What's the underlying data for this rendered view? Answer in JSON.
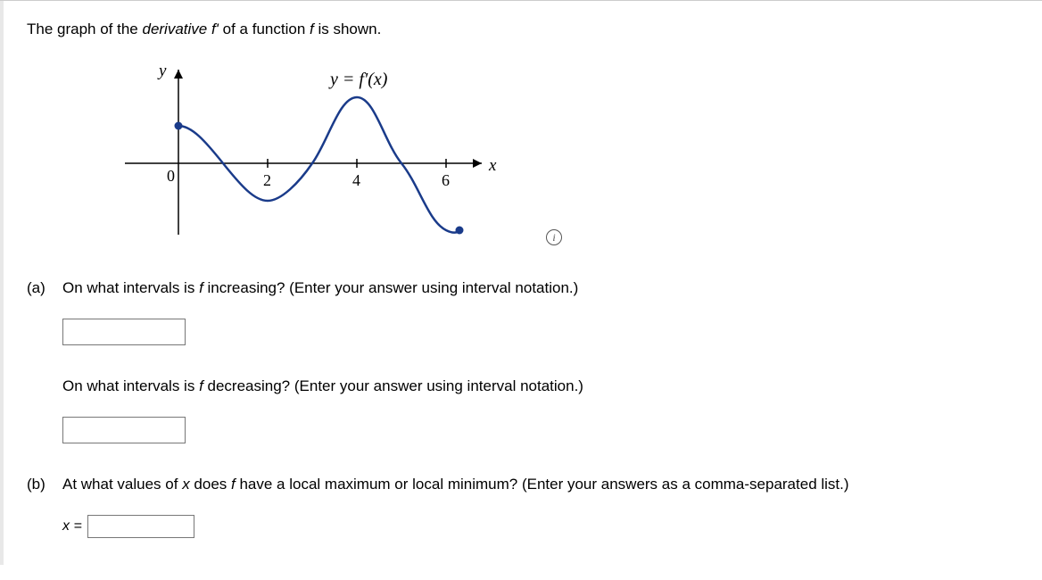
{
  "problem": {
    "prefix": "The graph of the ",
    "derivative_word": "derivative f'",
    "middle": " of a function ",
    "f_word": "f",
    "suffix": " is shown."
  },
  "graph": {
    "y_label": "y",
    "x_label": "x",
    "origin_label": "0",
    "ticks": [
      "2",
      "4",
      "6"
    ],
    "curve_label_prefix": "y = ",
    "curve_label_func": "f'(x)"
  },
  "chart_data": {
    "type": "line",
    "title": "y = f'(x)",
    "xlabel": "x",
    "ylabel": "y",
    "xlim": [
      0,
      7
    ],
    "ylim": [
      -2,
      2
    ],
    "x": [
      0.0,
      0.5,
      1.0,
      1.5,
      2.0,
      2.5,
      3.0,
      3.5,
      4.0,
      4.5,
      5.0,
      5.5,
      6.0,
      6.3
    ],
    "y": [
      1.0,
      0.8,
      0.0,
      -0.8,
      -1.0,
      -0.6,
      0.0,
      1.2,
      1.7,
      1.1,
      0.0,
      -1.2,
      -1.7,
      -1.8
    ],
    "series_name": "f'(x)",
    "endpoints": {
      "start_closed": true,
      "end_closed": true
    }
  },
  "parts": {
    "a": {
      "label": "(a)",
      "q1_pre": "On what intervals is ",
      "q1_f": "f",
      "q1_post": " increasing? (Enter your answer using interval notation.)",
      "q2_pre": "On what intervals is ",
      "q2_f": "f",
      "q2_post": " decreasing? (Enter your answer using interval notation.)"
    },
    "b": {
      "label": "(b)",
      "q_pre": "At what values of ",
      "q_x": "x",
      "q_mid": " does ",
      "q_f": "f",
      "q_post": " have a local maximum or local minimum? (Enter your answers as a comma-separated list.)",
      "inline_label": "x ="
    }
  },
  "inputs": {
    "a1": "",
    "a2": "",
    "b": ""
  }
}
